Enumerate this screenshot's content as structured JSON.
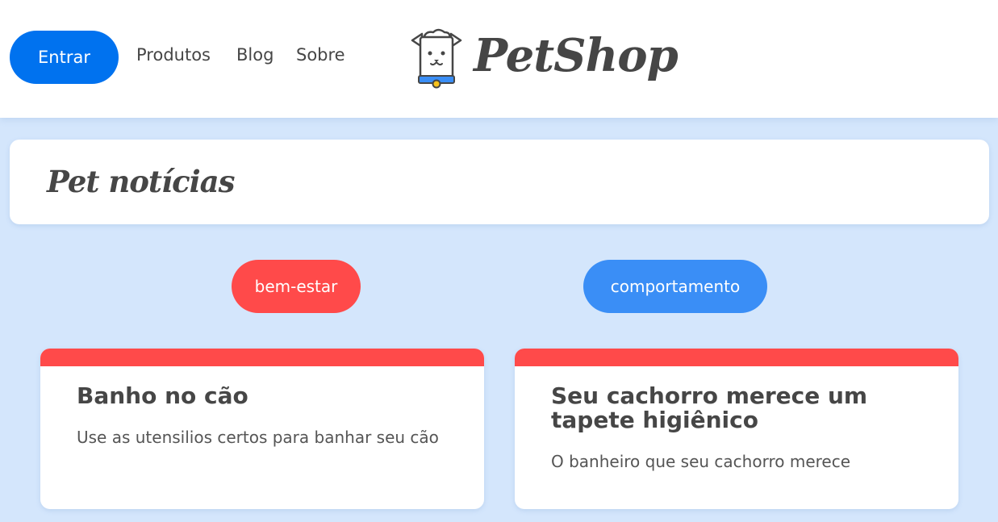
{
  "header": {
    "login_label": "Entrar",
    "nav": [
      "Produtos",
      "Blog",
      "Sobre"
    ],
    "logo_text": "PetShop"
  },
  "page": {
    "title": "Pet notícias"
  },
  "tags": [
    {
      "label": "bem-estar",
      "color": "#ff4a4a"
    },
    {
      "label": "comportamento",
      "color": "#3a8ef6"
    }
  ],
  "cards": [
    {
      "title": "Banho no cão",
      "description": "Use as utensilios certos para banhar seu cão",
      "bar_color": "#ff4a4a"
    },
    {
      "title": "Seu cachorro merece um tapete higiênico",
      "description": "O banheiro que seu cachorro merece",
      "bar_color": "#ff4a4a"
    }
  ],
  "colors": {
    "primary": "#0072ef",
    "background": "#d4e6fc",
    "text": "#464646"
  },
  "icons": {
    "logo": "dog-face-icon"
  }
}
